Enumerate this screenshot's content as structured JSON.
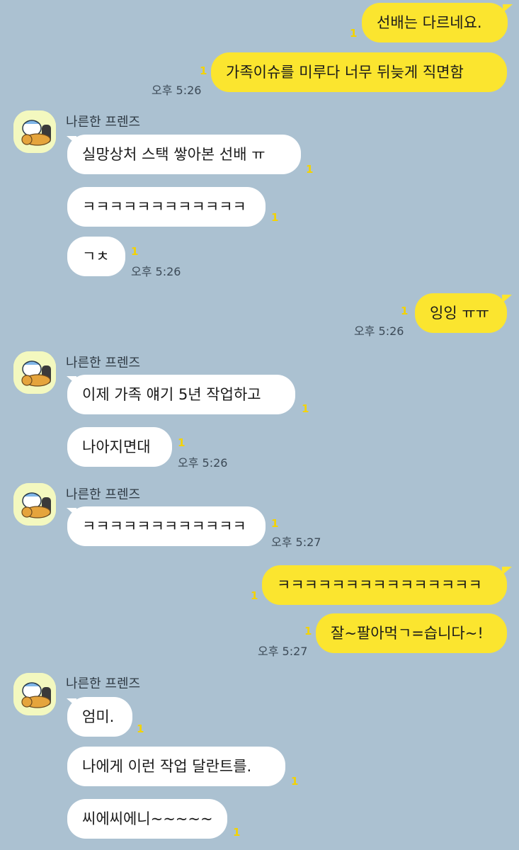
{
  "sender_name": "나른한 프렌즈",
  "unread_count": "1",
  "colors": {
    "background": "#abc1d1",
    "my_bubble": "#fbe52f",
    "other_bubble": "#ffffff",
    "unread": "#f4d300"
  },
  "messages": [
    {
      "from": "me",
      "text": "선배는 다르네요.",
      "unread": "1"
    },
    {
      "from": "me",
      "text": "가족이슈를 미루다 너무 뒤늦게 직면함",
      "unread": "1",
      "time": "오후 5:26"
    },
    {
      "from": "other",
      "text": "실망상처 스택 쌓아본 선배 ㅠ",
      "unread": "1"
    },
    {
      "from": "other",
      "text": "ㅋㅋㅋㅋㅋㅋㅋㅋㅋㅋㅋㅋ",
      "unread": "1"
    },
    {
      "from": "other",
      "text": "ㄱㅊ",
      "unread": "1",
      "time": "오후 5:26"
    },
    {
      "from": "me",
      "text": "잉잉 ㅠㅠ",
      "unread": "1",
      "time": "오후 5:26"
    },
    {
      "from": "other",
      "text": "이제 가족 얘기 5년 작업하고",
      "unread": "1"
    },
    {
      "from": "other",
      "text": "나아지면대",
      "unread": "1",
      "time": "오후 5:26"
    },
    {
      "from": "other",
      "text": "ㅋㅋㅋㅋㅋㅋㅋㅋㅋㅋㅋㅋ",
      "unread": "1",
      "time": "오후 5:27"
    },
    {
      "from": "me",
      "text": "ㅋㅋㅋㅋㅋㅋㅋㅋㅋㅋㅋㅋㅋㅋㅋ",
      "unread": "1"
    },
    {
      "from": "me",
      "text": "잘~팔아먹ㄱ=습니다~!",
      "unread": "1",
      "time": "오후 5:27"
    },
    {
      "from": "other",
      "text": "엄미.",
      "unread": "1"
    },
    {
      "from": "other",
      "text": "나에게 이런 작업 달란트를.",
      "unread": "1"
    },
    {
      "from": "other",
      "text": "씨에씨에니~~~~~",
      "unread": "1"
    }
  ]
}
